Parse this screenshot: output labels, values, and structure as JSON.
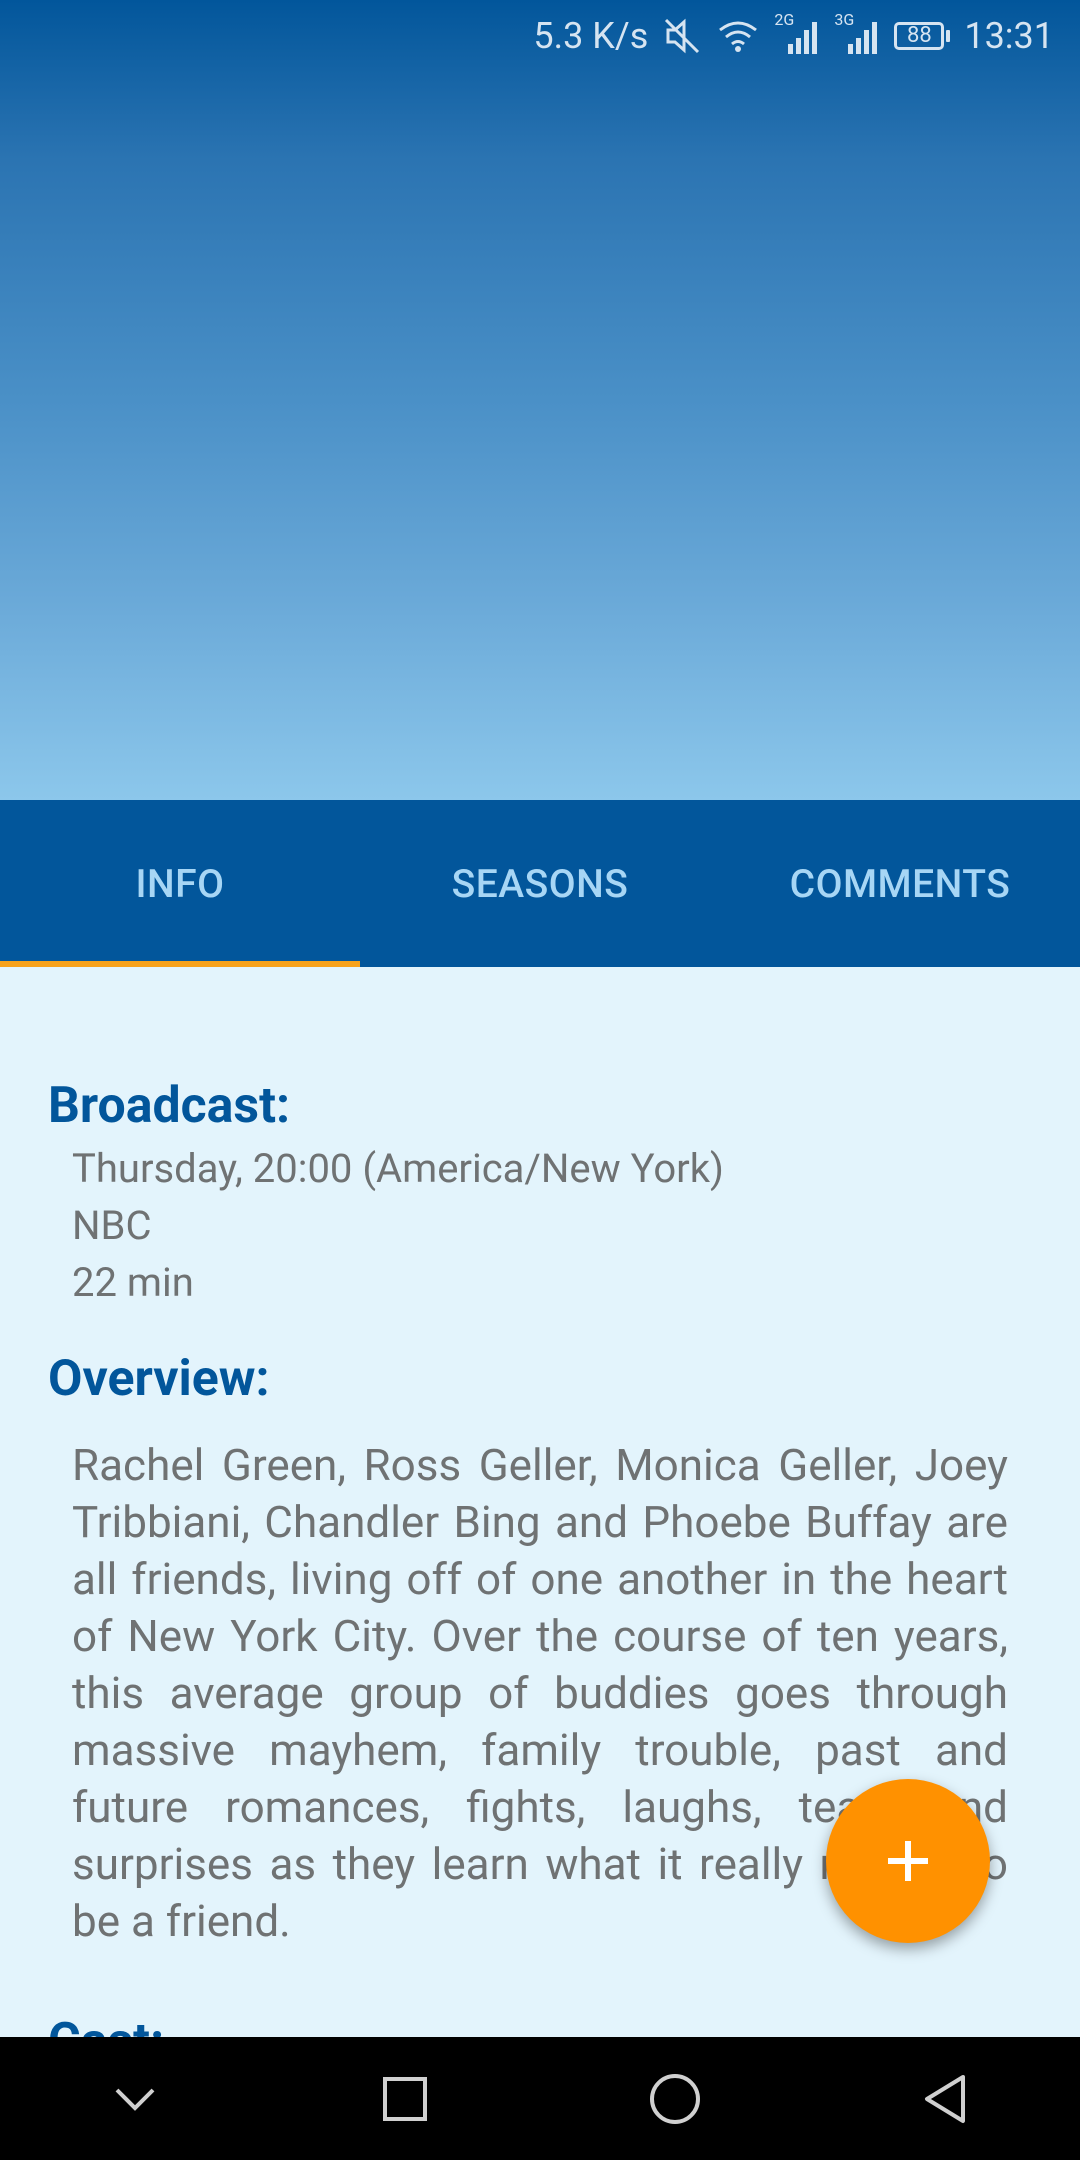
{
  "status_bar": {
    "speed": "5.3 K/s",
    "network_2g": "2G",
    "network_3g": "3G",
    "battery": "88",
    "time": "13:31"
  },
  "tabs": [
    {
      "label": "INFO",
      "active": true
    },
    {
      "label": "SEASONS",
      "active": false
    },
    {
      "label": "COMMENTS",
      "active": false
    }
  ],
  "broadcast": {
    "title": "Broadcast:",
    "schedule": "Thursday, 20:00 (America/New York)",
    "network": "NBC",
    "runtime": "22 min"
  },
  "overview": {
    "title": "Overview:",
    "text": "Rachel Green, Ross Geller, Monica Geller, Joey Tribbiani, Chandler Bing and Phoebe Buffay are all friends, living off of one another in the heart of New York City. Over the course of ten years, this average group of buddies goes through massive mayhem, family trouble, past and future romances, fights, laughs, tears and surprises as they learn what it really means to be a friend."
  },
  "cast": {
    "title": "Cast:"
  },
  "fab": {
    "icon": "plus-icon"
  },
  "colors": {
    "primary": "#02569b",
    "accent": "#ff9100",
    "tab_indicator": "#f7a21b",
    "background": "#e3f4fc"
  }
}
